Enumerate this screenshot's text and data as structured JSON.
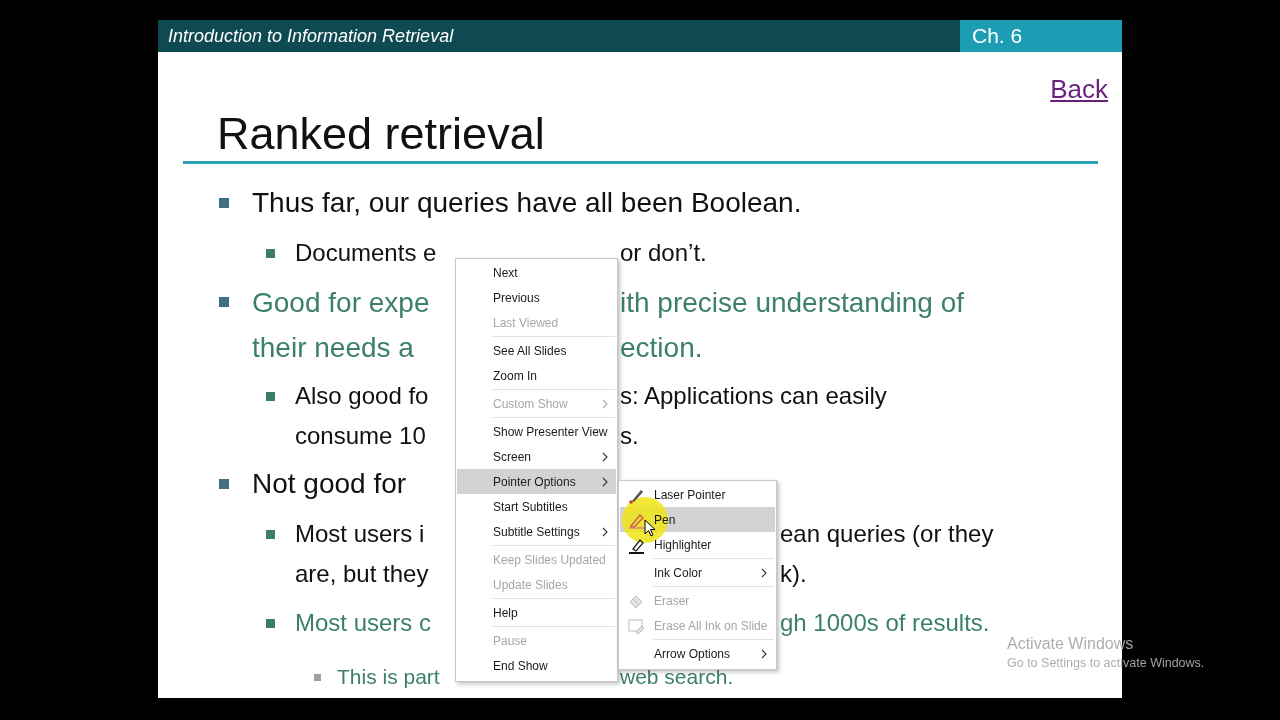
{
  "header": {
    "title": "Introduction to Information Retrieval",
    "chapter": "Ch. 6"
  },
  "back_link": "Back",
  "title": "Ranked retrieval",
  "bullets": [
    {
      "kind": "plain",
      "lines": [
        {
          "left": "Thus far, our queries have all been Boolean."
        }
      ],
      "children": [
        {
          "kind": "plain",
          "lines": [
            {
              "left": "Documents e",
              "right": "or don’t."
            }
          ]
        }
      ]
    },
    {
      "kind": "emphasis",
      "lines": [
        {
          "left": "Good for expe",
          "right": "ith precise understanding of"
        },
        {
          "left": "their needs a",
          "right": "ection."
        }
      ],
      "children": [
        {
          "kind": "plain",
          "lines": [
            {
              "left": "Also good fo",
              "right": "s: Applications can easily"
            },
            {
              "left": "consume 10",
              "right": "s."
            }
          ]
        }
      ]
    },
    {
      "kind": "plain",
      "lines": [
        {
          "left": "Not good for"
        }
      ],
      "children": [
        {
          "kind": "plain",
          "lines": [
            {
              "left": "Most users i",
              "right": "ean queries (or they"
            },
            {
              "left": "are, but they",
              "right": "k)."
            }
          ]
        },
        {
          "kind": "emphasis",
          "lines": [
            {
              "left": "Most users c",
              "right": "gh 1000s of results."
            }
          ],
          "children": [
            {
              "kind": "emphasis",
              "lines": [
                {
                  "left": "This is part",
                  "right": "web search."
                }
              ]
            }
          ]
        }
      ]
    }
  ],
  "context_menu": {
    "items": [
      {
        "kind": "item",
        "label": "Next",
        "disabled": false,
        "submenu": false,
        "selected": false
      },
      {
        "kind": "item",
        "label": "Previous",
        "disabled": false,
        "submenu": false,
        "selected": false
      },
      {
        "kind": "item",
        "label": "Last Viewed",
        "disabled": true,
        "submenu": false,
        "selected": false
      },
      {
        "kind": "separator"
      },
      {
        "kind": "item",
        "label": "See All Slides",
        "disabled": false,
        "submenu": false,
        "selected": false
      },
      {
        "kind": "item",
        "label": "Zoom In",
        "disabled": false,
        "submenu": false,
        "selected": false
      },
      {
        "kind": "separator"
      },
      {
        "kind": "item",
        "label": "Custom Show",
        "disabled": true,
        "submenu": true,
        "selected": false
      },
      {
        "kind": "separator"
      },
      {
        "kind": "item",
        "label": "Show Presenter View",
        "disabled": false,
        "submenu": false,
        "selected": false
      },
      {
        "kind": "item",
        "label": "Screen",
        "disabled": false,
        "submenu": true,
        "selected": false
      },
      {
        "kind": "item",
        "label": "Pointer Options",
        "disabled": false,
        "submenu": true,
        "selected": true
      },
      {
        "kind": "item",
        "label": "Start Subtitles",
        "disabled": false,
        "submenu": false,
        "selected": false
      },
      {
        "kind": "item",
        "label": "Subtitle Settings",
        "disabled": false,
        "submenu": true,
        "selected": false
      },
      {
        "kind": "separator"
      },
      {
        "kind": "item",
        "label": "Keep Slides Updated",
        "disabled": true,
        "submenu": false,
        "selected": false
      },
      {
        "kind": "item",
        "label": "Update Slides",
        "disabled": true,
        "submenu": false,
        "selected": false
      },
      {
        "kind": "separator"
      },
      {
        "kind": "item",
        "label": "Help",
        "disabled": false,
        "submenu": false,
        "selected": false
      },
      {
        "kind": "separator"
      },
      {
        "kind": "item",
        "label": "Pause",
        "disabled": true,
        "submenu": false,
        "selected": false
      },
      {
        "kind": "item",
        "label": "End Show",
        "disabled": false,
        "submenu": false,
        "selected": false
      }
    ]
  },
  "pointer_submenu": {
    "items": [
      {
        "kind": "item",
        "label": "Laser Pointer",
        "disabled": false,
        "submenu": false,
        "selected": false
      },
      {
        "kind": "item",
        "label": "Pen",
        "disabled": false,
        "submenu": false,
        "selected": true
      },
      {
        "kind": "item",
        "label": "Highlighter",
        "disabled": false,
        "submenu": false,
        "selected": false
      },
      {
        "kind": "separator"
      },
      {
        "kind": "item",
        "label": "Ink Color",
        "disabled": false,
        "submenu": true,
        "selected": false
      },
      {
        "kind": "separator"
      },
      {
        "kind": "item",
        "label": "Eraser",
        "disabled": true,
        "submenu": false,
        "selected": false
      },
      {
        "kind": "item",
        "label": "Erase All Ink on Slide",
        "disabled": true,
        "submenu": false,
        "selected": false
      },
      {
        "kind": "separator"
      },
      {
        "kind": "item",
        "label": "Arrow Options",
        "disabled": false,
        "submenu": true,
        "selected": false
      }
    ]
  },
  "activation_notice": {
    "title": "Activate Windows",
    "message": "Go to Settings to activate Windows."
  }
}
